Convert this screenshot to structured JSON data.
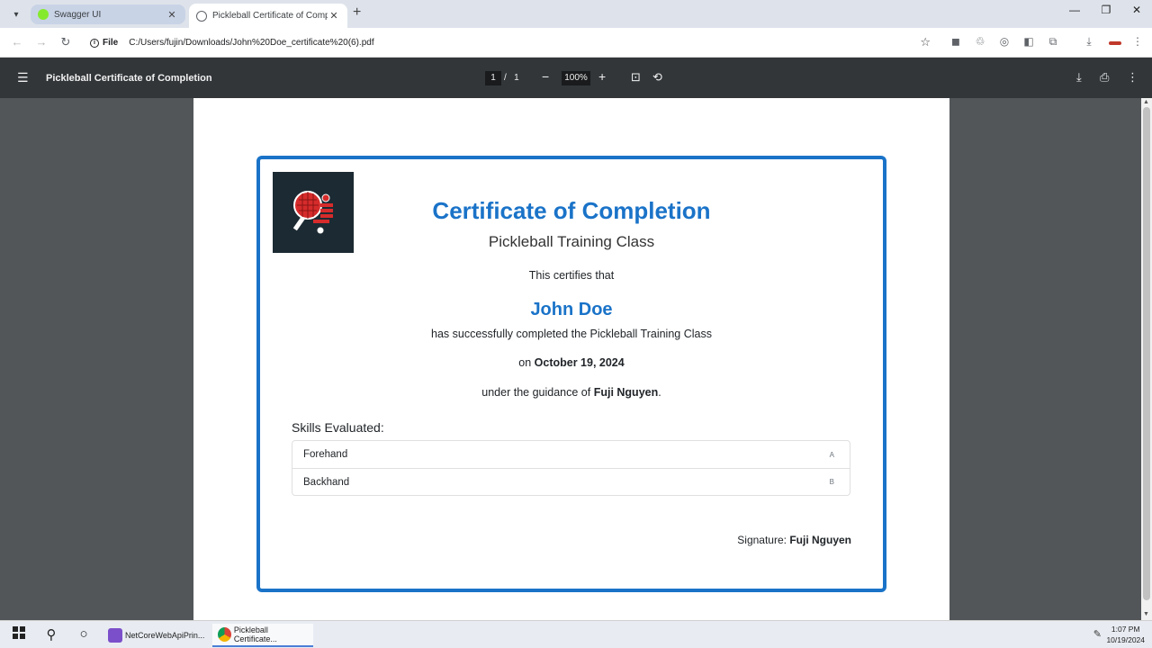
{
  "browser": {
    "tabs": [
      {
        "label": "Swagger UI",
        "active": false,
        "favicon_color": "#85ea2d"
      },
      {
        "label": "Pickleball Certificate of Comple",
        "active": true,
        "favicon_color": "#5f6368"
      }
    ],
    "address": {
      "scheme_label": "File",
      "url": "C:/Users/fujin/Downloads/John%20Doe_certificate%20(6).pdf"
    }
  },
  "pdf_viewer": {
    "title": "Pickleball Certificate of Completion",
    "page_current": "1",
    "page_separator": "/",
    "page_total": "1",
    "zoom": "100%"
  },
  "certificate": {
    "title": "Certificate of Completion",
    "subtitle": "Pickleball Training Class",
    "certifies": "This certifies that",
    "recipient": "John Doe",
    "completed_text": "has successfully completed the Pickleball Training Class",
    "date_prefix": "on",
    "date": "October 19, 2024",
    "guidance_prefix": "under the guidance of",
    "instructor": "Fuji Nguyen",
    "guidance_suffix": ".",
    "skills_heading": "Skills Evaluated:",
    "skills": [
      {
        "name": "Forehand",
        "grade": "A"
      },
      {
        "name": "Backhand",
        "grade": "B"
      }
    ],
    "signature_label": "Signature:",
    "signature_name": "Fuji Nguyen"
  },
  "taskbar": {
    "apps": [
      {
        "label": "NetCoreWebApiPrin...",
        "active": false
      },
      {
        "label": "Pickleball Certificate...",
        "active": true
      }
    ],
    "time": "1:07 PM",
    "date": "10/19/2024"
  },
  "colors": {
    "accent": "#1a73c8",
    "viewer_bg": "#525659",
    "toolbar_bg": "#323639"
  }
}
